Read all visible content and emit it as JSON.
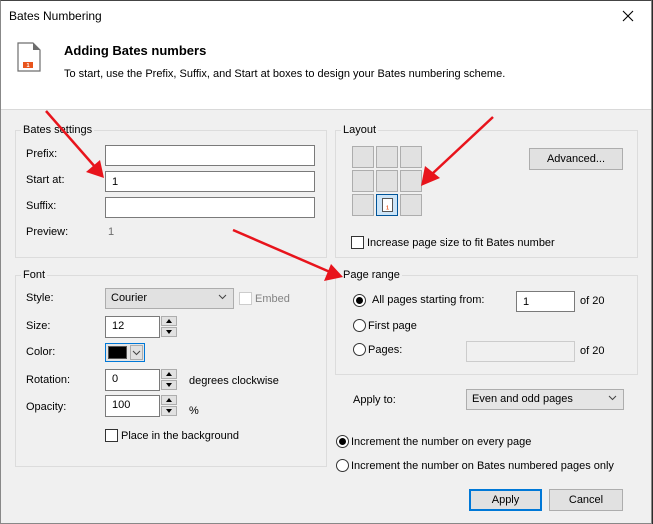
{
  "window": {
    "title": "Bates Numbering",
    "close_icon": "close-icon"
  },
  "header": {
    "icon": "bates-page-icon",
    "icon_badge": "1",
    "title": "Adding Bates numbers",
    "description": "To start, use the Prefix, Suffix, and Start at boxes to design your Bates numbering scheme."
  },
  "bates_settings": {
    "legend": "Bates settings",
    "prefix_label": "Prefix:",
    "prefix_value": "",
    "start_label": "Start at:",
    "start_value": "1",
    "suffix_label": "Suffix:",
    "suffix_value": "",
    "preview_label": "Preview:",
    "preview_value": "1"
  },
  "layout": {
    "legend": "Layout",
    "selected_position": "bottom-center",
    "cell_badge": "1",
    "advanced_label": "Advanced...",
    "increase_page_size_label": "Increase page size to fit Bates number",
    "increase_page_size_checked": false
  },
  "font": {
    "legend": "Font",
    "style_label": "Style:",
    "style_value": "Courier",
    "embed_label": "Embed",
    "embed_checked": false,
    "size_label": "Size:",
    "size_value": "12",
    "color_label": "Color:",
    "color_value": "#000000",
    "rotation_label": "Rotation:",
    "rotation_value": "0",
    "rotation_unit": "degrees clockwise",
    "opacity_label": "Opacity:",
    "opacity_value": "100",
    "opacity_unit": "%",
    "background_label": "Place in the background",
    "background_checked": false
  },
  "page_range": {
    "legend": "Page range",
    "all_pages_label": "All pages starting from:",
    "all_pages_value": "1",
    "all_pages_of": "of 20",
    "first_page_label": "First page",
    "pages_label": "Pages:",
    "pages_value": "",
    "pages_of": "of 20",
    "selected": "all_pages"
  },
  "apply_to": {
    "label": "Apply to:",
    "value": "Even and odd pages"
  },
  "increment": {
    "every_page_label": "Increment the number on every page",
    "bates_pages_label": "Increment the number on Bates numbered pages only",
    "selected": "every_page"
  },
  "buttons": {
    "apply_label": "Apply",
    "cancel_label": "Cancel"
  },
  "annotations": {
    "arrow_color": "#e8141c",
    "arrows": [
      "points-to-start-at-field",
      "points-to-layout-grid",
      "points-to-page-range"
    ]
  },
  "colors": {
    "accent": "#0078d7",
    "badge_orange": "#e8541c"
  }
}
